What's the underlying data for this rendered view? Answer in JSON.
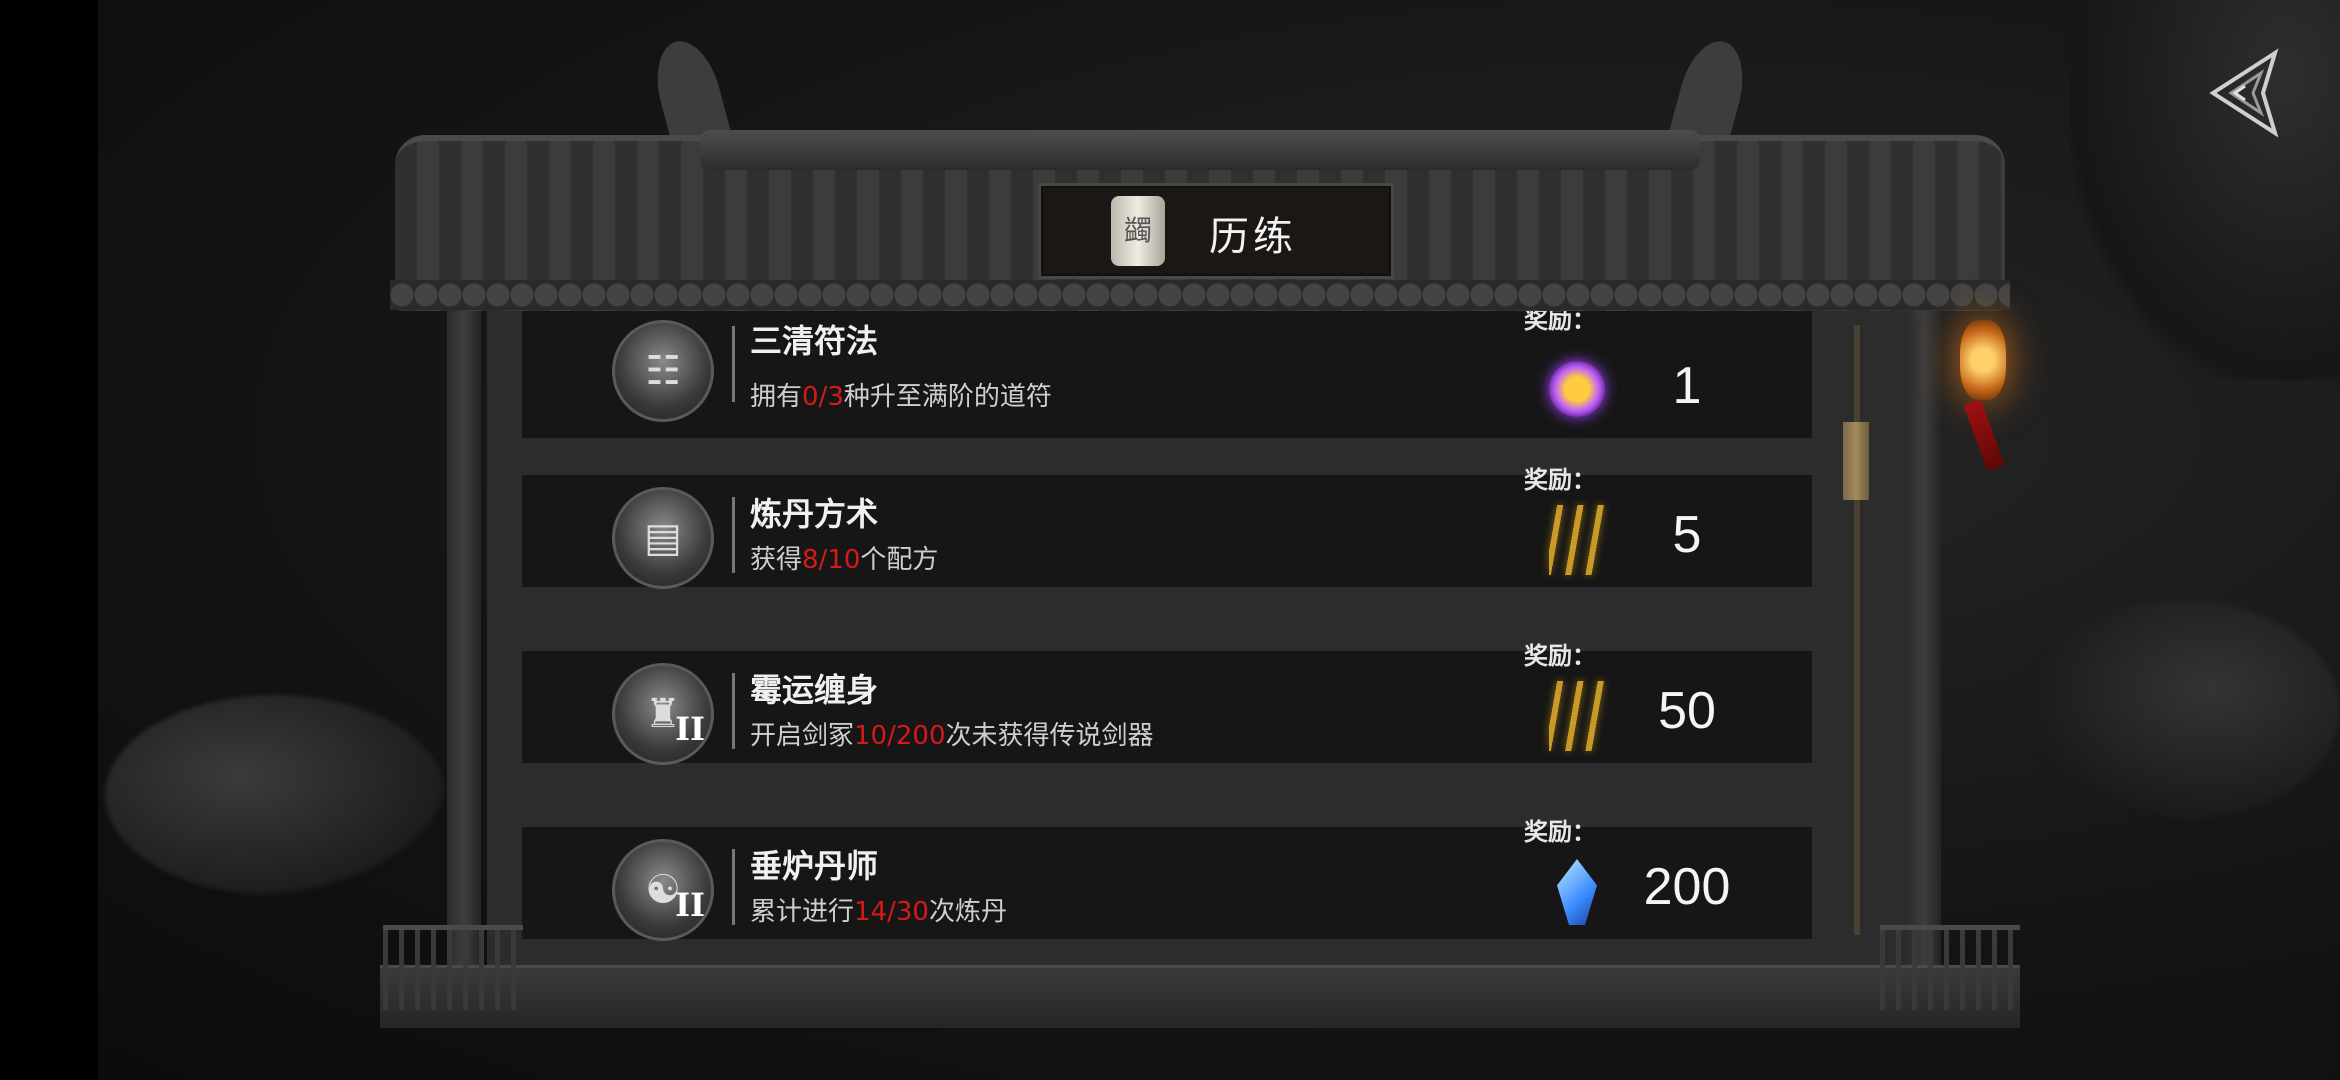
{
  "header": {
    "title": "历练",
    "scroll_glyph": "蠲"
  },
  "list": {
    "items": [
      {
        "title": "三清符法",
        "desc_pre": "拥有",
        "desc_prog": "0/3",
        "desc_post": "种升至满阶的道符",
        "reward_label": "奖励：",
        "reward_icon": "purple-orb-icon",
        "reward_value": "1",
        "icon_tier": "",
        "icon_glyph": "☷"
      },
      {
        "title": "炼丹方术",
        "desc_pre": "获得",
        "desc_prog": "8/10",
        "desc_post": "个配方",
        "reward_label": "奖励：",
        "reward_icon": "golden-arrows-icon",
        "reward_value": "5",
        "icon_tier": "",
        "icon_glyph": "▤"
      },
      {
        "title": "霉运缠身",
        "desc_pre": "开启剑冢",
        "desc_prog": "10/200",
        "desc_post": "次未获得传说剑器",
        "reward_label": "奖励：",
        "reward_icon": "golden-arrows-icon",
        "reward_value": "50",
        "icon_tier": "II",
        "icon_glyph": "♜"
      },
      {
        "title": "垂炉丹师",
        "desc_pre": "累计进行",
        "desc_prog": "14/30",
        "desc_post": "次炼丹",
        "reward_label": "奖励：",
        "reward_icon": "blue-crystal-icon",
        "reward_value": "200",
        "icon_tier": "II",
        "icon_glyph": "☯"
      }
    ]
  },
  "colors": {
    "progress_red": "#d51a1a",
    "scroll_thumb": "#a58c5a"
  },
  "scroll": {
    "position_fraction": 0.15
  },
  "nav": {
    "back_icon": "back-arrow-icon"
  }
}
